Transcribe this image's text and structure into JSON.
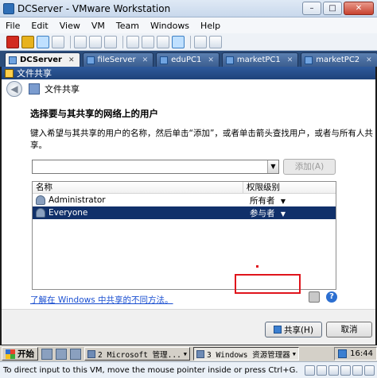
{
  "window": {
    "title": "DCServer - VMware Workstation",
    "buttons": {
      "minimize": "–",
      "maximize": "□",
      "close": "✕"
    }
  },
  "menu": [
    "File",
    "Edit",
    "View",
    "VM",
    "Team",
    "Windows",
    "Help"
  ],
  "tabs": [
    {
      "label": "DCServer",
      "active": true
    },
    {
      "label": "fileServer",
      "active": false
    },
    {
      "label": "eduPC1",
      "active": false
    },
    {
      "label": "marketPC1",
      "active": false
    },
    {
      "label": "marketPC2",
      "active": false
    }
  ],
  "dialog": {
    "title": "文件共享",
    "nav_title": "文件共享",
    "back_icon": "◀",
    "heading": "选择要与其共享的网络上的用户",
    "instruction": "键入希望与其共享的用户的名称，然后单击“添加”，或者单击箭头查找用户，或者与所有人共享。",
    "combo_value": "",
    "combo_arrow": "▼",
    "add_button": "添加(A)",
    "columns": {
      "name": "名称",
      "permission": "权限级别"
    },
    "rows": [
      {
        "name": "Administrator",
        "permission": "所有者",
        "selected": false
      },
      {
        "name": "Everyone",
        "permission": "参与者",
        "selected": true
      }
    ],
    "perm_arrow": "▼",
    "help_link": "了解在 Windows 中共享的不同方法。",
    "help_icon": "?",
    "share_button": "共享(H)",
    "cancel_button": "取消"
  },
  "taskbar": {
    "start": "开始",
    "tasks": [
      {
        "label": "2 Microsoft 管理...",
        "pressed": false
      },
      {
        "label": "3 Windows 资源管理器",
        "pressed": true
      }
    ],
    "task_arrow": "▼",
    "clock": "16:44"
  },
  "statusbar": {
    "text": "To direct input to this VM, move the mouse pointer inside or press Ctrl+G."
  },
  "colors": {
    "highlight_box": "#e0141c",
    "selection": "#10306a",
    "link": "#1a4fd1",
    "vm_tab_bar": "#2b4c7a"
  },
  "icons": {
    "app": "vmware-icon",
    "share": "share-icon",
    "user": "user-group-icon",
    "help": "help-icon",
    "printer": "printer-icon"
  }
}
